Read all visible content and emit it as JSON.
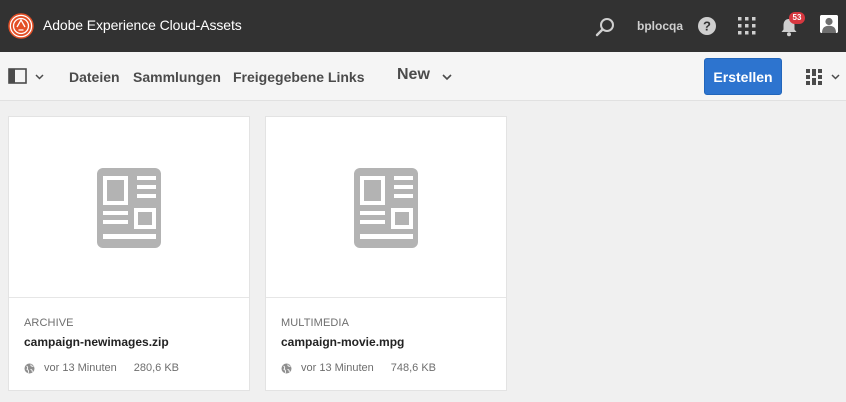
{
  "shell": {
    "title": "Adobe Experience Cloud-Assets",
    "user": "bplocqa",
    "notifications_count": "53",
    "icons": [
      "adobe-experience-cloud-logo",
      "search-icon",
      "help-icon",
      "apps-grid-icon",
      "bell-icon",
      "user-avatar"
    ]
  },
  "toolbar": {
    "tabs": [
      {
        "label": "Dateien"
      },
      {
        "label": "Sammlungen"
      },
      {
        "label": "Freigegebene Links"
      }
    ],
    "view_title": "New",
    "create_label": "Erstellen",
    "icons": [
      "rail-toggle-icon",
      "chevron-down-icon",
      "view-switcher-icon"
    ]
  },
  "cards": [
    {
      "type": "ARCHIVE",
      "name": "campaign-newimages.zip",
      "modified": "vor 13 Minuten",
      "size": "280,6 KB"
    },
    {
      "type": "MULTIMEDIA",
      "name": "campaign-movie.mpg",
      "modified": "vor 13 Minuten",
      "size": "748,6 KB"
    }
  ],
  "colors": {
    "shell_bg": "#323232",
    "toolbar_bg": "#f5f5f5",
    "page_bg": "#f0f0f0",
    "accent": "#2d74cf",
    "badge": "#d7373f",
    "placeholder_icon": "#b3b3b3"
  }
}
